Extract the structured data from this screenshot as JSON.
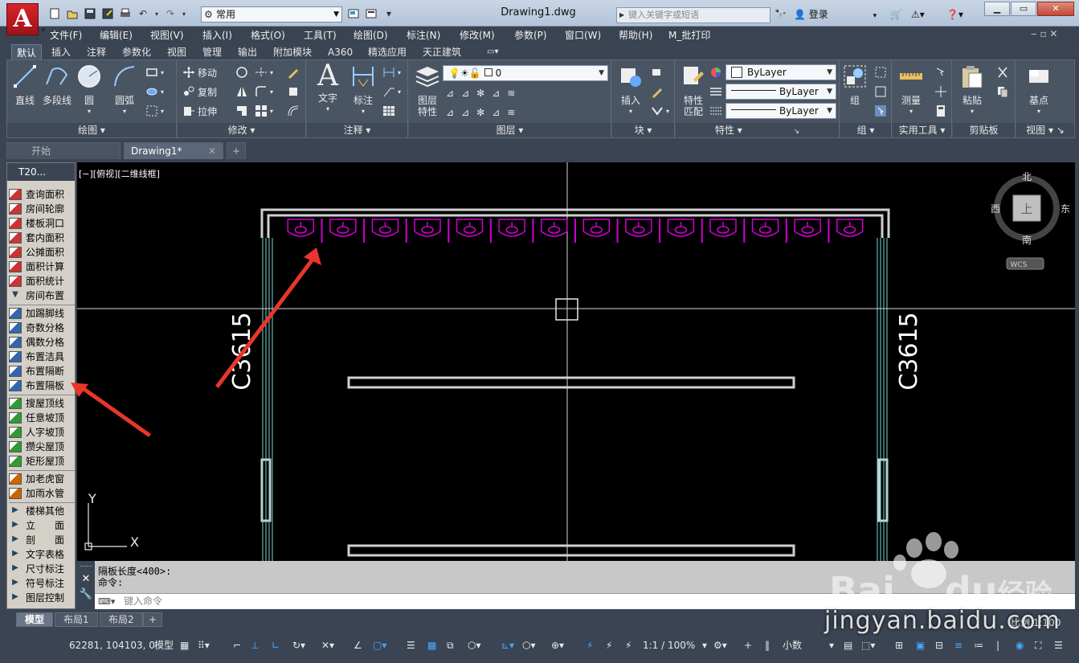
{
  "app": {
    "logo_letter": "A",
    "document_title": "Drawing1.dwg"
  },
  "quick_access": {
    "workspace": "常用"
  },
  "titlebar": {
    "search_placeholder": "键入关键字或短语",
    "login": "登录"
  },
  "menu": [
    "文件(F)",
    "编辑(E)",
    "视图(V)",
    "插入(I)",
    "格式(O)",
    "工具(T)",
    "绘图(D)",
    "标注(N)",
    "修改(M)",
    "参数(P)",
    "窗口(W)",
    "帮助(H)",
    "M_批打印"
  ],
  "ribbon_tabs": [
    "默认",
    "插入",
    "注释",
    "参数化",
    "视图",
    "管理",
    "输出",
    "附加模块",
    "A360",
    "精选应用",
    "天正建筑"
  ],
  "ribbon": {
    "draw": {
      "title": "绘图",
      "line": "直线",
      "polyline": "多段线",
      "circle": "圆",
      "arc": "圆弧"
    },
    "modify": {
      "title": "修改",
      "move": "移动",
      "copy": "复制",
      "stretch": "拉伸"
    },
    "annotation": {
      "title": "注释",
      "text": "文字",
      "dimension": "标注"
    },
    "layers": {
      "title": "图层",
      "props_line1": "图层",
      "props_line2": "特性",
      "current_layer": "0"
    },
    "block": {
      "title": "块",
      "insert": "插入"
    },
    "properties": {
      "title": "特性",
      "match_line1": "特性",
      "match_line2": "匹配",
      "color": "ByLayer",
      "linetype": "ByLayer",
      "lineweight": "ByLayer"
    },
    "groups": {
      "title": "组",
      "group": "组"
    },
    "utilities": {
      "title": "实用工具",
      "measure": "测量"
    },
    "clipboard": {
      "title": "剪贴板",
      "paste": "粘贴"
    },
    "view": {
      "title": "视图",
      "base": "基点"
    }
  },
  "file_tabs": {
    "start": "开始",
    "drawing": "Drawing1*"
  },
  "palette": {
    "title": "T20...",
    "group1": [
      "查询面积",
      "房间轮廓",
      "楼板洞口",
      "套内面积",
      "公摊面积",
      "面积计算",
      "面积统计",
      "房间布置"
    ],
    "group2": [
      "加踢脚线",
      "奇数分格",
      "偶数分格",
      "布置洁具",
      "布置隔断",
      "布置隔板"
    ],
    "group3": [
      "搜屋顶线",
      "任意坡顶",
      "人字坡顶",
      "攒尖屋顶",
      "矩形屋顶"
    ],
    "group4": [
      "加老虎窗",
      "加雨水管"
    ],
    "group5": [
      "楼梯其他",
      "立　　面",
      "剖　　面",
      "文字表格",
      "尺寸标注",
      "符号标注",
      "图层控制"
    ]
  },
  "canvas": {
    "view_label": "[−][俯视][二维线框]",
    "window_label_left": "C3615",
    "window_label_right": "C3615",
    "viewcube": {
      "north": "北",
      "south": "南",
      "east": "东",
      "west": "西",
      "face": "上",
      "ucs": "WCS"
    },
    "axis_y": "Y",
    "axis_x": "X",
    "fixture_count": 14
  },
  "command": {
    "history_line1": "隔板长度<400>:",
    "history_line2": "命令:",
    "input_placeholder": "键入命令"
  },
  "layout_tabs": [
    "模型",
    "布局1",
    "布局2"
  ],
  "status": {
    "coords": "62281, 104103, 0",
    "model": "模型",
    "scale": "1:1 / 100%",
    "units": "小数",
    "drawing_scale": "比例 1:100"
  },
  "watermark": {
    "brand": "Bai",
    "brand2": "du",
    "brand_cn": "经验",
    "url": "jingyan.baidu.com"
  },
  "colors": {
    "accent_red": "#d8232a",
    "fixture_magenta": "#d000d0",
    "glass_cyan": "#7ad8d8",
    "arrow_red": "#e8362c"
  }
}
